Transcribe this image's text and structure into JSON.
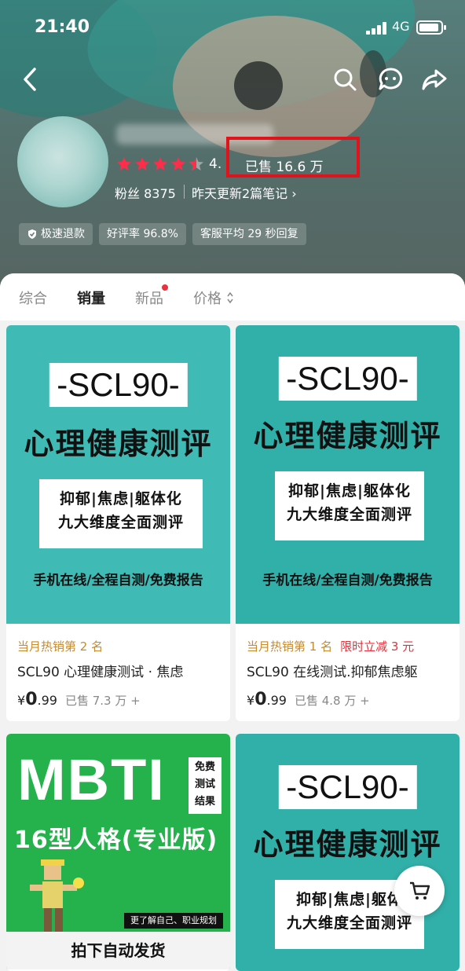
{
  "status_bar": {
    "time": "21:40",
    "network": "4G"
  },
  "shop": {
    "rating": "4.",
    "sold": "已售 16.6 万",
    "fans": "粉丝 8375",
    "update": "昨天更新2篇笔记 ›",
    "badges": [
      {
        "label": "极速退款",
        "icon": "shield-check-icon"
      },
      {
        "label": "好评率 96.8%"
      },
      {
        "label": "客服平均 29 秒回复"
      }
    ]
  },
  "tabs": [
    "综合",
    "销量",
    "新品",
    "价格"
  ],
  "active_tab": "销量",
  "products": [
    {
      "poster": {
        "badge": "-SCL90-",
        "title": "心理健康测评",
        "line1": "抑郁|焦虑|躯体化",
        "line2": "九大维度全面测评",
        "footer": "手机在线/全程自测/免费报告"
      },
      "tag": "当月热销第 2 名",
      "promo": "",
      "name": "SCL90 心理健康测试 · 焦虑",
      "price_symbol": "¥",
      "price_int": "0",
      "price_dec": ".99",
      "sold": "已售 7.3 万 +"
    },
    {
      "poster": {
        "badge": "-SCL90-",
        "title": "心理健康测评",
        "line1": "抑郁|焦虑|躯体化",
        "line2": "九大维度全面测评",
        "footer": "手机在线/全程自测/免费报告"
      },
      "tag": "当月热销第 1 名",
      "promo": "限时立减 3 元",
      "name": "SCL90 在线测试.抑郁焦虑躯",
      "price_symbol": "¥",
      "price_int": "0",
      "price_dec": ".99",
      "sold": "已售 4.8 万 +"
    },
    {
      "poster": {
        "big": "MBTI",
        "free": [
          "免费",
          "测试",
          "结果"
        ],
        "sub": "16型人格(专业版)",
        "note": "更了解自己、职业规划",
        "bottom": "拍下自动发货"
      }
    },
    {
      "poster": {
        "badge": "-SCL90-",
        "title": "心理健康测评",
        "line1": "抑郁|焦虑|躯体",
        "line2": "九大维度全面测评"
      }
    }
  ]
}
